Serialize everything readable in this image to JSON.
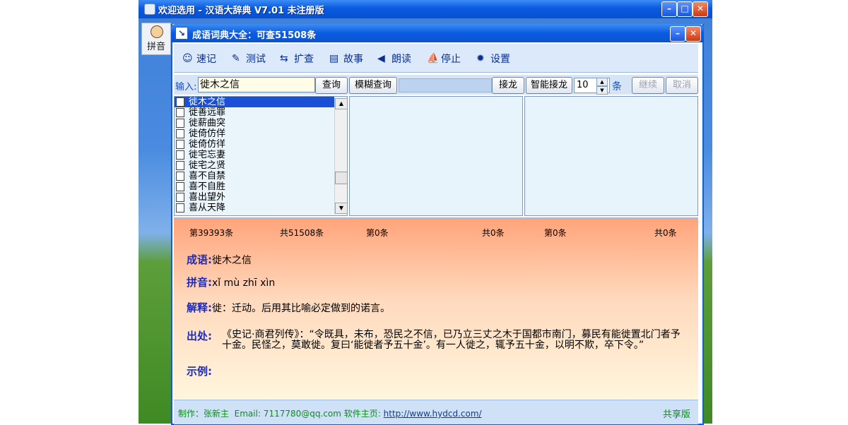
{
  "outer_window": {
    "title": "欢迎选用 - 汉语大辞典 V7.01 未注册版"
  },
  "side_tab": {
    "label": "拼音"
  },
  "inner_window": {
    "title": "成语词典大全：可查51508条"
  },
  "toolbar": {
    "items": [
      {
        "label": "速记",
        "icon": "smiley-icon"
      },
      {
        "label": "测试",
        "icon": "test-icon"
      },
      {
        "label": "扩查",
        "icon": "expand-icon"
      },
      {
        "label": "故事",
        "icon": "story-icon"
      },
      {
        "label": "朗读",
        "icon": "speaker-icon"
      },
      {
        "label": "停止",
        "icon": "stop-icon"
      },
      {
        "label": "设置",
        "icon": "gear-icon"
      }
    ]
  },
  "search": {
    "label": "输入:",
    "value": "徙木之信",
    "query_button": "查询",
    "fuzzy_button": "模糊查询",
    "chain_button": "接龙",
    "smart_chain_button": "智能接龙",
    "count_value": "10",
    "count_unit": "条",
    "continue_button": "继续",
    "cancel_button": "取消"
  },
  "list_items": [
    "徙木之信",
    "徙善远罪",
    "徙薪曲突",
    "徙倚仿佯",
    "徙倚仿徉",
    "徙宅忘妻",
    "徙宅之贤",
    "喜不自禁",
    "喜不自胜",
    "喜出望外",
    "喜从天降"
  ],
  "stats": {
    "current": "第39393条",
    "total": "共51508条",
    "p2_current": "第0条",
    "p2_total": "共0条",
    "p3_current": "第0条",
    "p3_total": "共0条"
  },
  "detail": {
    "idiom_label": "成语:",
    "idiom": "徙木之信",
    "pinyin_label": "拼音:",
    "pinyin": "xǐ mù zhī xìn",
    "meaning_label": "解释:",
    "meaning": "徙：迁动。后用其比喻必定做到的诺言。",
    "source_label": "出处:",
    "source": "《史记·商君列传》：“令既具，未布，恐民之不信，已乃立三丈之木于国都市南门，募民有能徙置北门者予十金。民怪之，莫敢徙。复曰‘能徙者予五十金’。有一人徙之，辄予五十金，以明不欺，卒下令。”",
    "example_label": "示例:"
  },
  "status": {
    "author": "制作：张新主",
    "email": "Email: 7117780@qq.com",
    "homepage_label": "软件主页:",
    "homepage_url": "http://www.hydcd.com/",
    "share": "共享版"
  }
}
